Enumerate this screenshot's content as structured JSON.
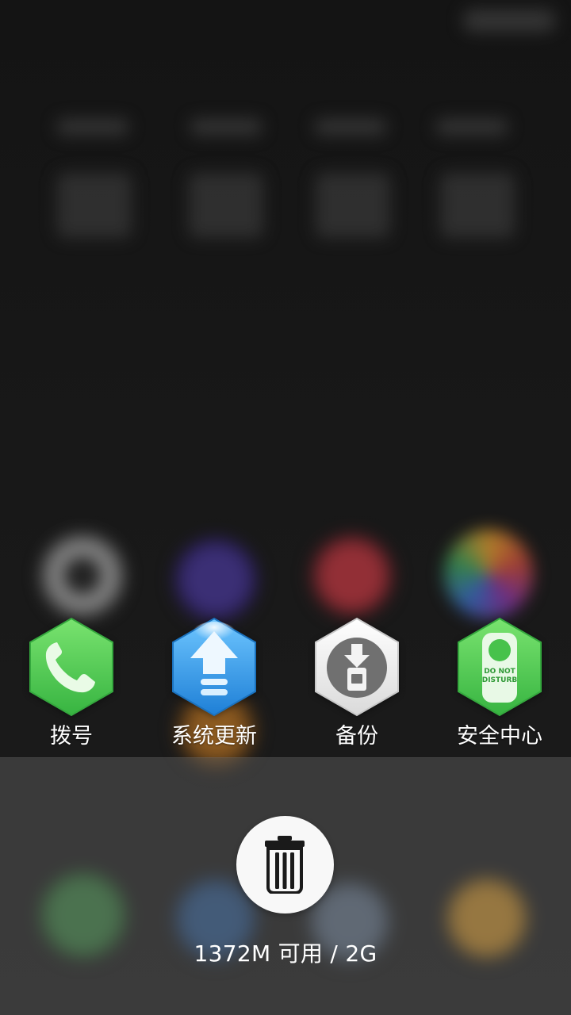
{
  "screen": {
    "theme": "android-recent-tasks-overlay"
  },
  "shortcuts": [
    {
      "label": "拨号",
      "icon": "phone-icon",
      "color": "#48c953"
    },
    {
      "label": "系统更新",
      "icon": "update-arrow-icon",
      "color": "#1f87df"
    },
    {
      "label": "备份",
      "icon": "backup-download-icon",
      "color": "#ececec"
    },
    {
      "label": "安全中心",
      "icon": "do-not-disturb-icon",
      "color": "#48c953",
      "icon_text": "DO NOT DISTURB"
    }
  ],
  "memory": {
    "status": "1372M 可用 / 2G"
  },
  "icons": {
    "clean_button": "trash-icon"
  },
  "colors": {
    "background": "#1b1b1b",
    "overlay": "#5a5a5a",
    "button": "#f8f8f8",
    "text": "#ffffff"
  }
}
